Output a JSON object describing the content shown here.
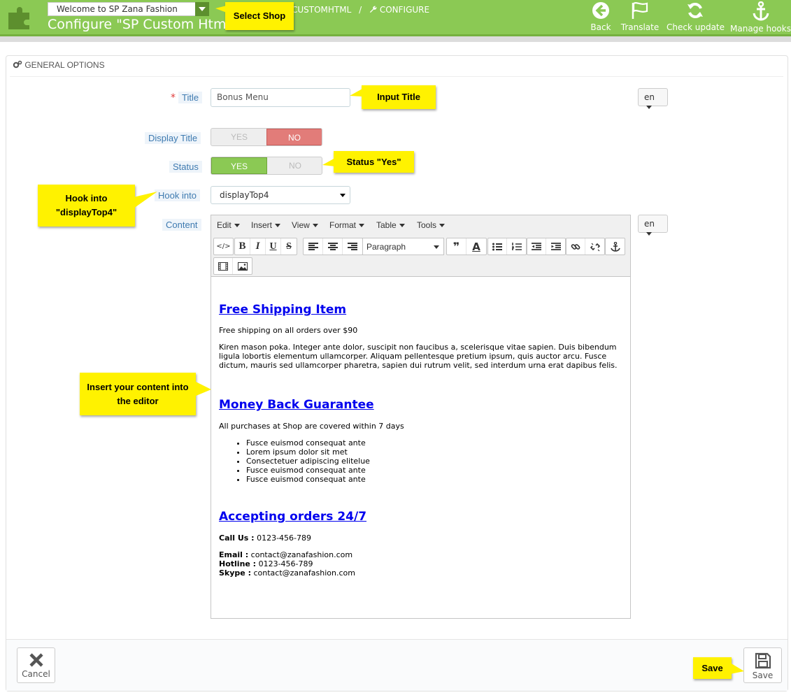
{
  "header": {
    "shop_select_value": "Welcome to SP Zana Fashion",
    "page_title": "Configure \"SP Custom Html\"",
    "breadcrumb": [
      "CUSTOMHTML",
      "CONFIGURE"
    ],
    "toolbar": {
      "back": "Back",
      "translate": "Translate",
      "check_update": "Check update",
      "manage_hooks": "Manage hooks"
    }
  },
  "panel": {
    "heading": "GENERAL OPTIONS",
    "title_label": "Title",
    "title_value": "Bonus Menu",
    "lang": "en",
    "display_title_label": "Display Title",
    "status_label": "Status",
    "yes": "YES",
    "no": "NO",
    "hook_label": "Hook into",
    "hook_value": "displayTop4",
    "content_label": "Content"
  },
  "editor": {
    "menus": [
      "Edit",
      "Insert",
      "View",
      "Format",
      "Table",
      "Tools"
    ],
    "format_select": "Paragraph",
    "content": {
      "h1": "Free Shipping Item",
      "p1": "Free shipping on all orders over $90",
      "p2": "Kiren mason poka. Integer ante dolor, suscipit non faucibus a, scelerisque vitae sapien. Duis bibendum ligula lobortis elementum ullamcorper. Aliquam pellentesque pretium ipsum, quis auctor arcu. Fusce dictum, mauris sed ullamcorper pharetra, sapien dui rutrum velit, sed interdum urna erat dapibus felis.",
      "h2": "Money Back Guarantee",
      "p3": "All purchases at Shop are covered within 7 days",
      "list": [
        "Fusce euismod consequat ante",
        "Lorem ipsum dolor sit met",
        "Consectetuer adipiscing elitelue",
        "Fusce euismod consequat ante",
        "Fusce euismod consequat ante"
      ],
      "h3": "Accepting orders 24/7",
      "call_label": "Call Us :",
      "call_value": " 0123-456-789",
      "email_label": "Email :",
      "email_value": " contact@zanafashion.com",
      "hotline_label": "Hotline :",
      "hotline_value": " 0123-456-789",
      "skype_label": "Skype :",
      "skype_value": " contact@zanafashion.com"
    }
  },
  "footer": {
    "cancel": "Cancel",
    "save": "Save"
  },
  "callouts": {
    "select_shop": "Select Shop",
    "input_title": "Input Title",
    "status_yes": "Status \"Yes\"",
    "hook_line1": "Hook into",
    "hook_line2": "\"displayTop4\"",
    "insert_line1": "Insert your content into",
    "insert_line2": "the editor",
    "save": "Save"
  },
  "colors": {
    "header_green": "#8bc954",
    "callout_yellow": "#fff200",
    "no_red": "#e27c79",
    "link_blue": "#0000ee"
  }
}
